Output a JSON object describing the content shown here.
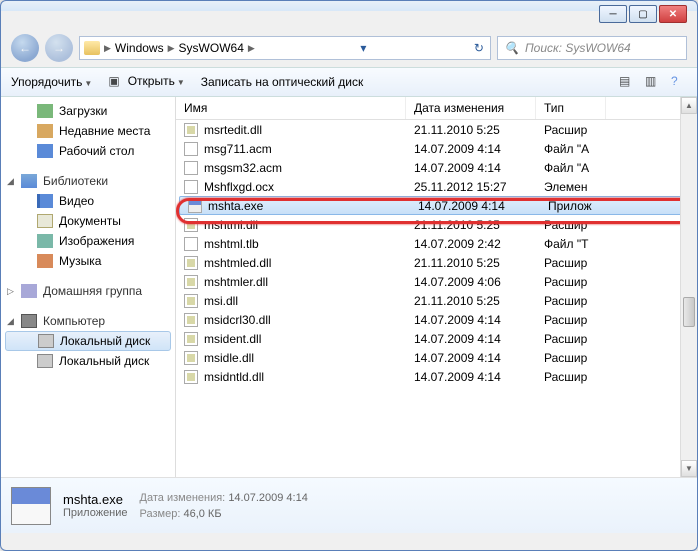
{
  "breadcrumb": {
    "part1": "Windows",
    "part2": "SysWOW64"
  },
  "search": {
    "placeholder": "Поиск: SysWOW64"
  },
  "toolbar": {
    "organize": "Упорядочить",
    "open": "Открыть",
    "burn": "Записать на оптический диск"
  },
  "sidebar": {
    "downloads": "Загрузки",
    "recent": "Недавние места",
    "desktop": "Рабочий стол",
    "libraries": "Библиотеки",
    "videos": "Видео",
    "documents": "Документы",
    "pictures": "Изображения",
    "music": "Музыка",
    "homegroup": "Домашняя группа",
    "computer": "Компьютер",
    "localdisk": "Локальный диск",
    "localdisk2": "Локальный диск"
  },
  "columns": {
    "name": "Имя",
    "date": "Дата изменения",
    "type": "Тип"
  },
  "files": [
    {
      "name": "msrtedit.dll",
      "date": "21.11.2010 5:25",
      "type": "Расшиp",
      "icon": "dll"
    },
    {
      "name": "msg711.acm",
      "date": "14.07.2009 4:14",
      "type": "Файл \"A",
      "icon": "file"
    },
    {
      "name": "msgsm32.acm",
      "date": "14.07.2009 4:14",
      "type": "Файл \"A",
      "icon": "file"
    },
    {
      "name": "Mshflxgd.ocx",
      "date": "25.11.2012 15:27",
      "type": "Элемен",
      "icon": "file"
    },
    {
      "name": "mshta.exe",
      "date": "14.07.2009 4:14",
      "type": "Прилож",
      "icon": "exe",
      "selected": true
    },
    {
      "name": "mshtml.dll",
      "date": "21.11.2010 5:25",
      "type": "Расшиp",
      "icon": "dll"
    },
    {
      "name": "mshtml.tlb",
      "date": "14.07.2009 2:42",
      "type": "Файл \"T",
      "icon": "file"
    },
    {
      "name": "mshtmled.dll",
      "date": "21.11.2010 5:25",
      "type": "Расшиp",
      "icon": "dll"
    },
    {
      "name": "mshtmler.dll",
      "date": "14.07.2009 4:06",
      "type": "Расшиp",
      "icon": "dll"
    },
    {
      "name": "msi.dll",
      "date": "21.11.2010 5:25",
      "type": "Расшиp",
      "icon": "dll"
    },
    {
      "name": "msidcrl30.dll",
      "date": "14.07.2009 4:14",
      "type": "Расшиp",
      "icon": "dll"
    },
    {
      "name": "msident.dll",
      "date": "14.07.2009 4:14",
      "type": "Расшиp",
      "icon": "dll"
    },
    {
      "name": "msidle.dll",
      "date": "14.07.2009 4:14",
      "type": "Расшиp",
      "icon": "dll"
    },
    {
      "name": "msidntld.dll",
      "date": "14.07.2009 4:14",
      "type": "Расшиp",
      "icon": "dll"
    }
  ],
  "details": {
    "name": "mshta.exe",
    "type": "Приложение",
    "date_label": "Дата изменения:",
    "date": "14.07.2009 4:14",
    "size_label": "Размер:",
    "size": "46,0 КБ"
  }
}
